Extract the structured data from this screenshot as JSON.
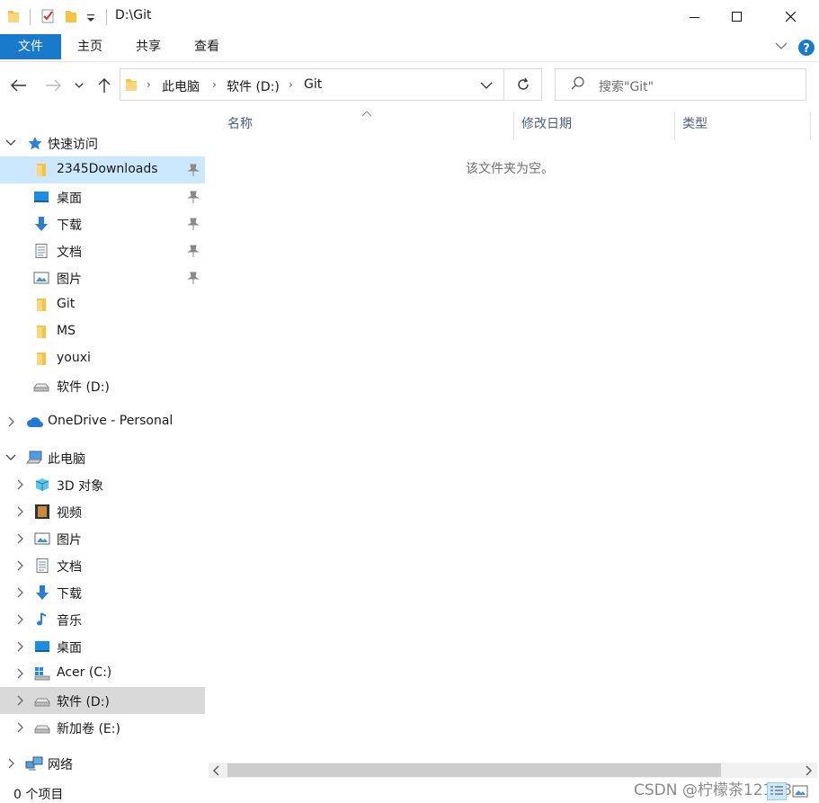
{
  "window": {
    "title": "D:\\Git"
  },
  "ribbon": {
    "tabs": [
      "文件",
      "主页",
      "共享",
      "查看"
    ]
  },
  "address": {
    "crumbs": [
      "此电脑",
      "软件 (D:)",
      "Git"
    ]
  },
  "search": {
    "placeholder": "搜索\"Git\""
  },
  "nav": {
    "quick_access": {
      "label": "快速访问",
      "items": [
        "2345Downloads",
        "桌面",
        "下载",
        "文档",
        "图片",
        "Git",
        "MS",
        "youxi",
        "软件 (D:)"
      ]
    },
    "onedrive": {
      "label": "OneDrive - Personal"
    },
    "this_pc": {
      "label": "此电脑",
      "items": [
        "3D 对象",
        "视频",
        "图片",
        "文档",
        "下载",
        "音乐",
        "桌面",
        "Acer (C:)",
        "软件 (D:)",
        "新加卷 (E:)"
      ]
    },
    "network": {
      "label": "网络"
    }
  },
  "columns": [
    "名称",
    "修改日期",
    "类型"
  ],
  "content": {
    "empty_message": "该文件夹为空。"
  },
  "status": {
    "item_count": "0 个项目"
  },
  "watermark": "CSDN @柠檬茶12138",
  "colors": {
    "accent": "#1979ca",
    "selected": "#cce8ff",
    "current": "#d9d9d9",
    "folder": "#f6c342"
  }
}
